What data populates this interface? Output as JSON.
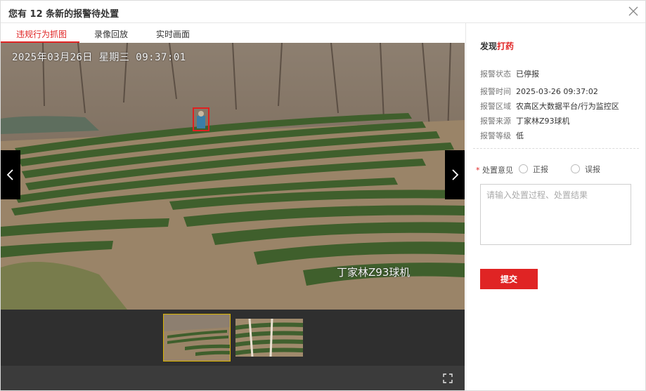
{
  "dialog": {
    "title": "您有 12 条新的报警待处置"
  },
  "tabs": [
    {
      "label": "违规行为抓图",
      "active": true
    },
    {
      "label": "录像回放",
      "active": false
    },
    {
      "label": "实时画面",
      "active": false
    }
  ],
  "viewer": {
    "osd_timestamp": "2025年03月26日 星期三 09:37:01",
    "camera_label": "丁家林Z93球机"
  },
  "alarm": {
    "found_prefix": "发现",
    "found_behavior": "打药",
    "fields": [
      {
        "key": "报警状态",
        "value": "已停报"
      },
      {
        "key": "报警时间",
        "value": "2025-03-26 09:37:02"
      },
      {
        "key": "报警区域",
        "value": "农高区大数据平台/行为监控区"
      },
      {
        "key": "报警来源",
        "value": "丁家林Z93球机"
      },
      {
        "key": "报警等级",
        "value": "低"
      }
    ]
  },
  "form": {
    "required_mark": "*",
    "opinion_label": "处置意见",
    "options": [
      "正报",
      "误报"
    ],
    "textarea_placeholder": "请输入处置过程、处置结果",
    "submit_label": "提交"
  },
  "colors": {
    "accent": "#e02424",
    "thumb_selected_border": "#d9b300"
  },
  "icons": {
    "close": "close-icon",
    "prev": "chevron-left-icon",
    "next": "chevron-right-icon",
    "fullscreen": "fullscreen-icon"
  }
}
